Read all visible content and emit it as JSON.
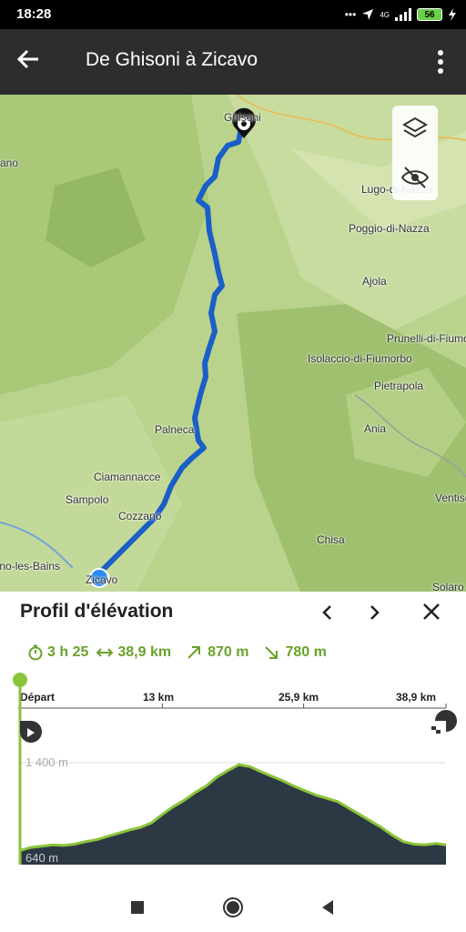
{
  "status": {
    "time": "18:28",
    "network": "4G",
    "battery": "56"
  },
  "header": {
    "title": "De Ghisoni à Zicavo"
  },
  "map": {
    "places": [
      {
        "name": "Ghisoni"
      },
      {
        "name": "ano"
      },
      {
        "name": "Lugo-di-Nazza"
      },
      {
        "name": "Poggio-di-Nazza"
      },
      {
        "name": "Ajola"
      },
      {
        "name": "Prunelli-di-Fiumorbo"
      },
      {
        "name": "Isolaccio-di-Fiumorbo"
      },
      {
        "name": "Pietrapola"
      },
      {
        "name": "Ania"
      },
      {
        "name": "Palneca"
      },
      {
        "name": "Ciamannacce"
      },
      {
        "name": "Sampolo"
      },
      {
        "name": "Cozzano"
      },
      {
        "name": "Ventiseri"
      },
      {
        "name": "Chisa"
      },
      {
        "name": "Guagno-les-Bains"
      },
      {
        "name": "Zicavo"
      },
      {
        "name": "Solaro"
      }
    ]
  },
  "panel": {
    "title": "Profil d'élévation",
    "stats": {
      "duration": "3 h 25",
      "distance": "38,9 km",
      "ascent": "870 m",
      "descent": "780 m"
    },
    "axis_labels": [
      "Départ",
      "13 km",
      "25,9 km",
      "38,9 km"
    ]
  },
  "chart_data": {
    "type": "area",
    "title": "",
    "xlabel": "",
    "ylabel": "",
    "xlim": [
      0,
      38.9
    ],
    "ylim": [
      640,
      1400
    ],
    "y_tick_labels": [
      "1 400 m",
      "640 m"
    ],
    "x_tick_labels": [
      "Départ",
      "13 km",
      "25,9 km",
      "38,9 km"
    ],
    "series": [
      {
        "x": [
          0,
          1,
          2,
          3,
          4,
          5,
          6,
          7,
          8,
          9,
          10,
          11,
          12,
          13,
          14,
          15,
          16,
          17,
          18,
          19,
          20,
          21,
          22,
          23,
          24,
          25,
          26,
          27,
          28,
          29,
          30,
          31,
          32,
          33,
          34,
          35,
          36,
          37,
          38,
          38.9
        ],
        "y": [
          720,
          745,
          755,
          765,
          760,
          770,
          790,
          805,
          830,
          855,
          880,
          900,
          935,
          1000,
          1060,
          1110,
          1170,
          1220,
          1290,
          1340,
          1385,
          1370,
          1330,
          1295,
          1260,
          1220,
          1185,
          1150,
          1125,
          1100,
          1050,
          1000,
          950,
          900,
          840,
          790,
          770,
          765,
          775,
          765
        ]
      }
    ],
    "colors": {
      "fill": "#2d3845",
      "line": "#8ac43a"
    }
  }
}
